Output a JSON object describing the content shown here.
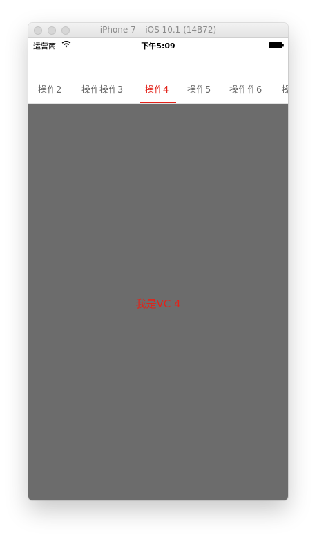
{
  "window": {
    "title": "iPhone 7 – iOS 10.1 (14B72)"
  },
  "status_bar": {
    "carrier": "运营商",
    "time": "下午5:09",
    "icons": [
      "wifi-icon",
      "battery-icon"
    ]
  },
  "tabs": {
    "items": [
      {
        "label": "操作2",
        "active": false
      },
      {
        "label": "操作操作3",
        "active": false
      },
      {
        "label": "操作4",
        "active": true
      },
      {
        "label": "操作5",
        "active": false
      },
      {
        "label": "操作作6",
        "active": false
      },
      {
        "label": "操",
        "active": false
      }
    ],
    "active_color": "#e2231a",
    "inactive_color": "#666666"
  },
  "content": {
    "label": "我是VC 4",
    "background": "#6c6c6c",
    "text_color": "#e2231a"
  }
}
